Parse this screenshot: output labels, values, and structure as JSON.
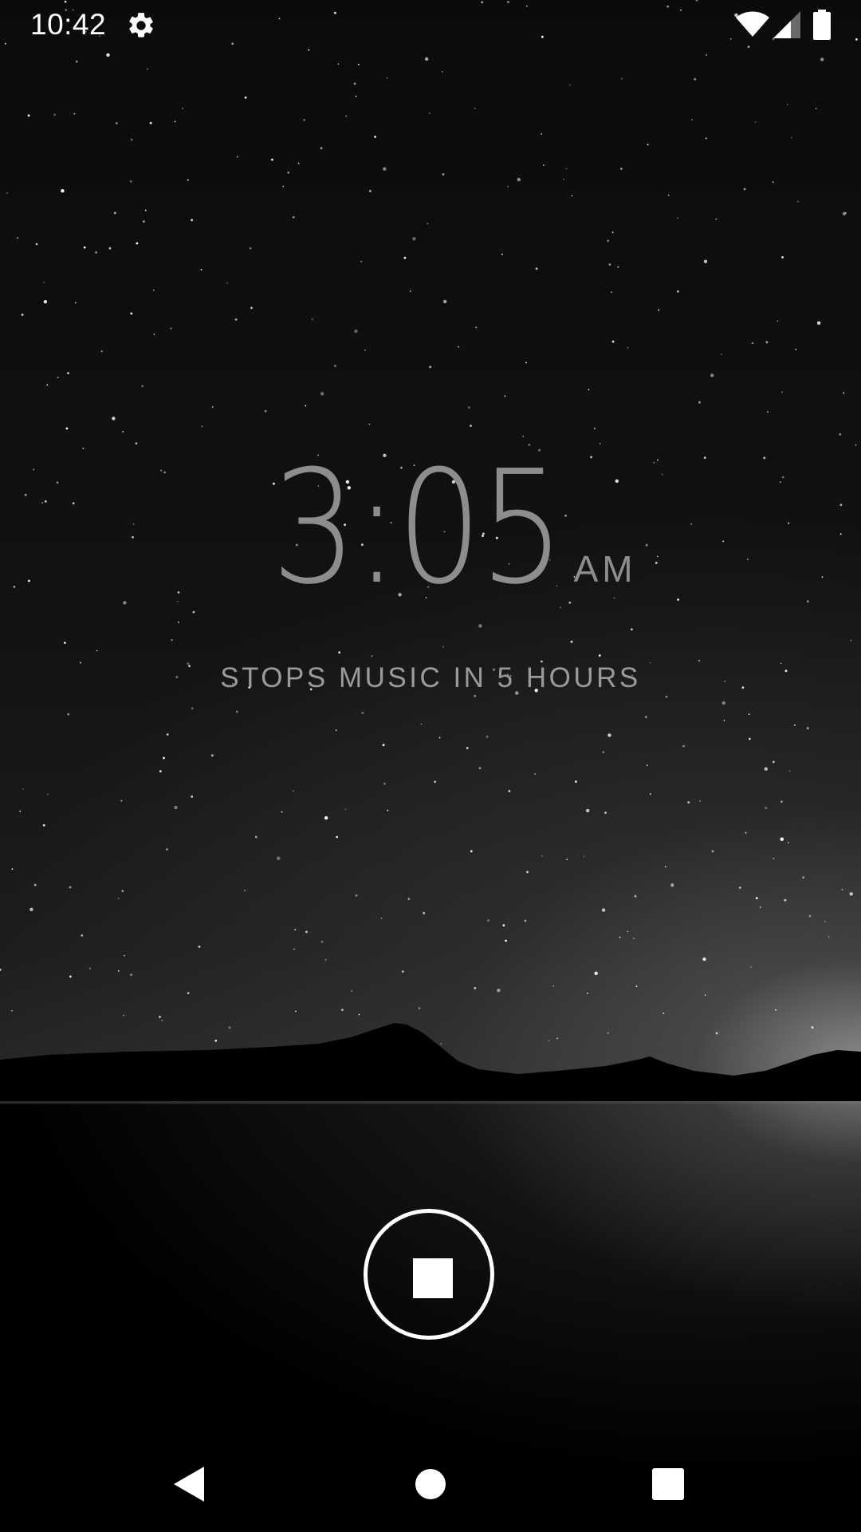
{
  "status_bar": {
    "time": "10:42",
    "icons": [
      "settings-icon",
      "wifi-icon",
      "cell-signal-icon",
      "battery-icon"
    ]
  },
  "clock": {
    "time": "3:05",
    "ampm": "AM"
  },
  "sleep_timer": {
    "caption": "STOPS MUSIC IN 5 HOURS"
  },
  "controls": {
    "stop_icon": "stop-icon"
  },
  "nav_bar": {
    "icons": [
      "back-icon",
      "home-icon",
      "recents-icon"
    ]
  },
  "colors": {
    "clock_text": "#8d8d8d",
    "caption_text": "#9a9a9a",
    "foreground": "#ffffff",
    "background": "#000000"
  }
}
